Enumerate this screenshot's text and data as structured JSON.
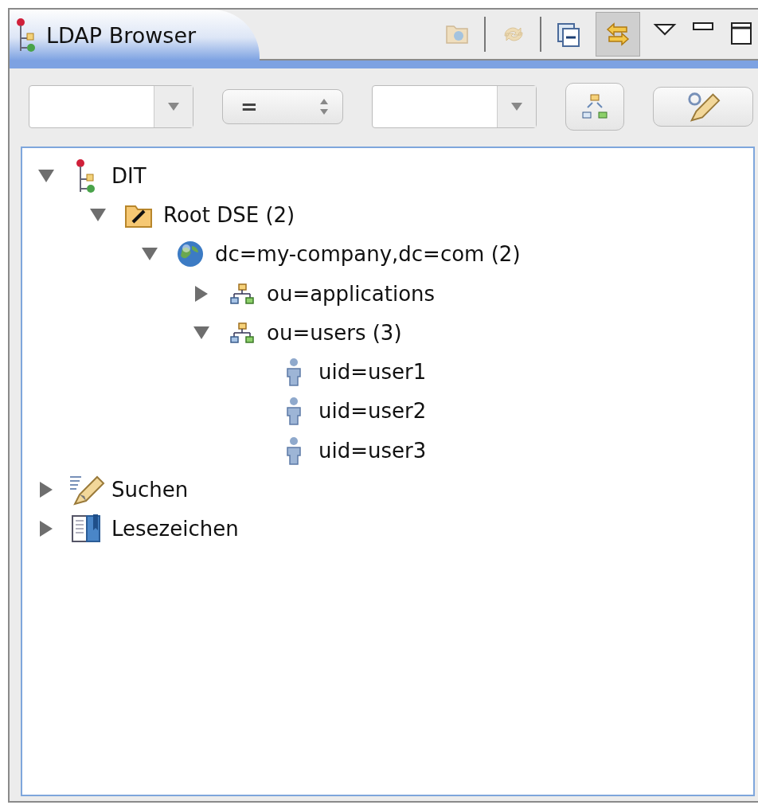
{
  "view": {
    "title": "LDAP Browser"
  },
  "toolbar": [
    {
      "kind": "folder-up",
      "disabled": true,
      "on": false
    },
    {
      "kind": "refresh",
      "disabled": true,
      "on": false
    },
    {
      "kind": "collapse",
      "disabled": false,
      "on": false
    },
    {
      "kind": "link",
      "disabled": false,
      "on": true
    }
  ],
  "filter": {
    "operator": "="
  },
  "tree": [
    {
      "label": "DIT",
      "kind": "dit",
      "expanded": true,
      "children": [
        {
          "label": "Root DSE (2)",
          "kind": "rootdse",
          "expanded": true,
          "children": [
            {
              "label": "dc=my-company,dc=com (2)",
              "kind": "domain",
              "expanded": true,
              "children": [
                {
                  "label": "ou=applications",
                  "kind": "ou",
                  "expanded": false
                },
                {
                  "label": "ou=users (3)",
                  "kind": "ou",
                  "expanded": true,
                  "children": [
                    {
                      "label": "uid=user1",
                      "kind": "person"
                    },
                    {
                      "label": "uid=user2",
                      "kind": "person"
                    },
                    {
                      "label": "uid=user3",
                      "kind": "person"
                    }
                  ]
                }
              ]
            }
          ]
        }
      ]
    },
    {
      "label": "Suchen",
      "kind": "search",
      "expanded": false
    },
    {
      "label": "Lesezeichen",
      "kind": "bookmarks",
      "expanded": false
    }
  ]
}
